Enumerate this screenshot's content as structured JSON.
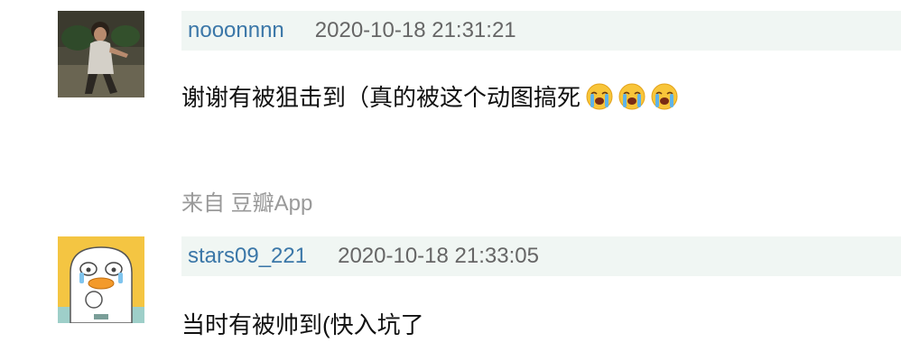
{
  "comments": [
    {
      "author": "nooonnnn",
      "time": "2020-10-18 21:31:21",
      "text": "谢谢有被狙击到（真的被这个动图搞死",
      "emoji_icon": "loudly-crying-face-icon",
      "emoji_count": 3,
      "source": "来自 豆瓣App"
    },
    {
      "author": "stars09_221",
      "time": "2020-10-18 21:33:05",
      "text": "当时有被帅到(快入坑了"
    }
  ],
  "colors": {
    "author_link": "#3b77a8",
    "meta_background": "#f0f6f3",
    "time_text": "#666666",
    "source_text": "#999999",
    "body_text": "#111111"
  }
}
